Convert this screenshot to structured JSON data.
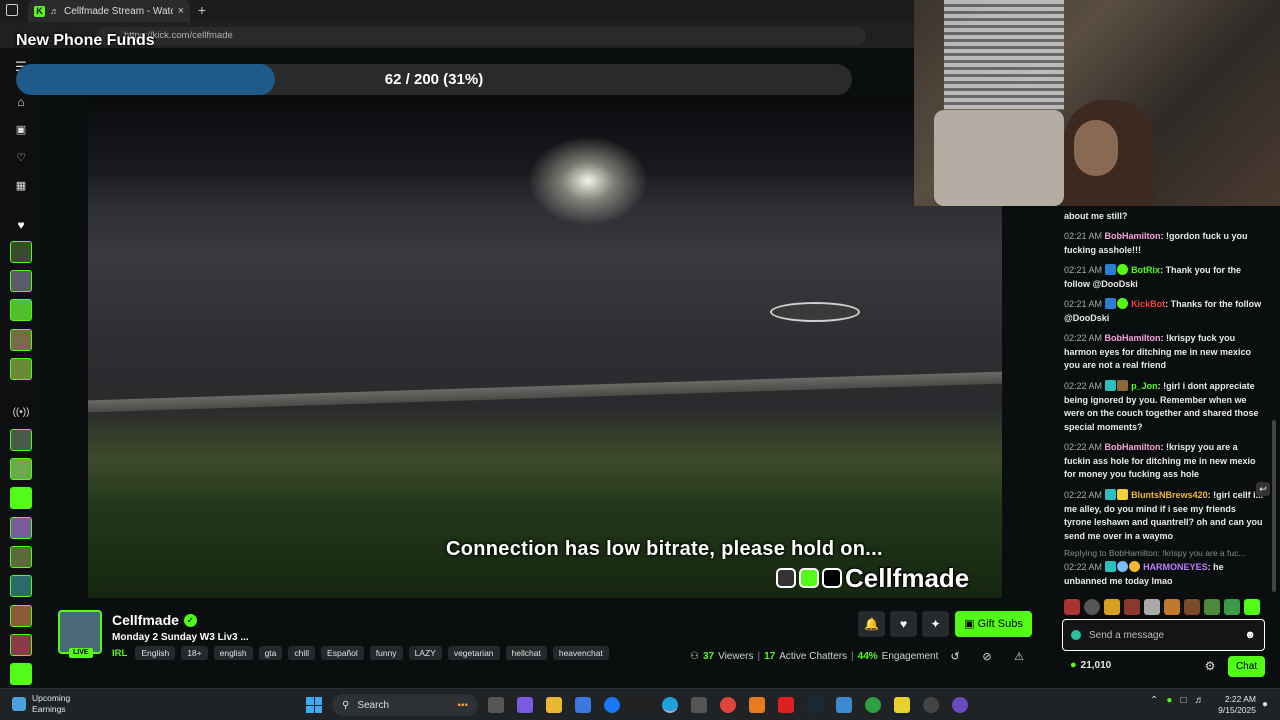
{
  "browser": {
    "tab_title": "Cellfmade Stream - Watch Li",
    "url": "https://kick.com/cellfmade"
  },
  "goal": {
    "title": "New Phone Funds",
    "progress_text": "62 / 200 (31%)",
    "progress_fraction": 0.31,
    "fill_color": "#1e5a8a"
  },
  "video": {
    "status_message": "Connection has low bitrate, please hold on...",
    "brand_name": "Cellfmade"
  },
  "chat": {
    "messages": [
      {
        "time": "",
        "user": "",
        "text": "about me still?",
        "user_color": "#e8e8e8"
      },
      {
        "time": "02:21 AM",
        "user": "BobHamilton",
        "text": "!gordon fuck u you fucking asshole!!!",
        "user_color": "#f6a1d8"
      },
      {
        "time": "02:21 AM",
        "user": "BotRix",
        "text": "Thank you for the follow @DooDski",
        "user_color": "#53fc18"
      },
      {
        "time": "02:21 AM",
        "user": "KickBot",
        "text": "Thanks for the follow @DooDski",
        "user_color": "#ff3b3b"
      },
      {
        "time": "02:22 AM",
        "user": "BobHamilton",
        "text": "!krispy fuck you harmon eyes for ditching me in new mexico you are not a real friend",
        "user_color": "#f6a1d8"
      },
      {
        "time": "02:22 AM",
        "user": "p_Jon",
        "text": "!girl i dont appreciate being ignored by you. Remember when we were on the couch together and shared those special moments?",
        "user_color": "#53fc18"
      },
      {
        "time": "02:22 AM",
        "user": "BobHamilton",
        "text": "!krispy you are a fuckin ass hole for ditching me in new mexio for money you fucking ass hole",
        "user_color": "#f6a1d8"
      },
      {
        "time": "02:22 AM",
        "user": "BluntsNBrews420",
        "text": "!girl cellf i... me alley, do you mind if i see my friends tyrone leshawn and quantrell? oh and can you send me over in a waymo",
        "user_color": "#f2b736"
      },
      {
        "time": "02:22 AM",
        "user": "HARMONEYES",
        "text": "he unbanned me today lmao",
        "user_color": "#c07cff"
      }
    ],
    "reply_preview": "Replying to BobHamilton: !krispy you are a fuc...",
    "input_placeholder": "Send a message",
    "points": "21,010",
    "chat_button": "Chat"
  },
  "channel": {
    "name": "Cellfmade",
    "live_label": "LIVE",
    "stream_title": "Monday 2 Sunday W3 Liv3 ...",
    "category": "IRL",
    "tags": [
      "English",
      "18+",
      "english",
      "gta",
      "chill",
      "Español",
      "funny",
      "LAZY",
      "vegetarian",
      "hellchat",
      "heavenchat"
    ],
    "gift_button": "Gift Subs",
    "viewers_num": "37",
    "viewers_label": "Viewers",
    "chatters_num": "17",
    "chatters_label": "Active Chatters",
    "engagement_num": "44%",
    "engagement_label": "Engagement"
  },
  "taskbar": {
    "weather_line1": "Upcoming",
    "weather_line2": "Earnings",
    "search_label": "Search",
    "time": "2:22 AM",
    "date": "9/15/2025"
  }
}
